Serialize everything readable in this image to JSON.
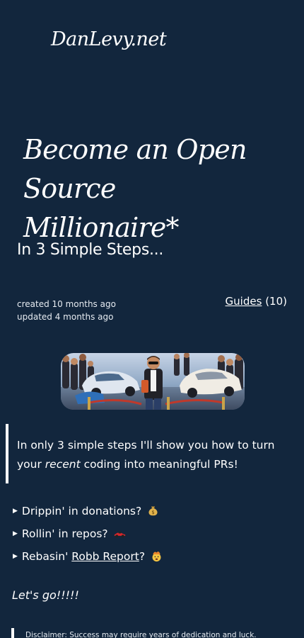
{
  "site": {
    "logo": "DanLevy.net"
  },
  "post": {
    "title": "Become an Open Source Millionaire*",
    "subtitle": "In 3 Simple Steps...",
    "created": "created 10 months ago",
    "updated": "updated 4 months ago",
    "category_label": "Guides",
    "category_count": "(10)"
  },
  "intro": {
    "part1": "In only 3 simple steps I'll show you how to turn your ",
    "emphasis": "recent",
    "part2": " coding into meaningful PRs!"
  },
  "steps": [
    {
      "text": "Drippin' in donations?",
      "icon": "money-bag-icon"
    },
    {
      "text": "Rollin' in repos?",
      "icon": "race-car-icon"
    },
    {
      "prefix": "Rebasin' ",
      "link": "Robb Report",
      "suffix": "?",
      "icon": "exploding-head-icon"
    }
  ],
  "cta": "Let's go!!!!!",
  "disclaimer": "Disclaimer: Success may require years of dedication and luck.",
  "colors": {
    "background": "#12263d",
    "text": "#ffffff",
    "quote_border": "#ffffff"
  }
}
